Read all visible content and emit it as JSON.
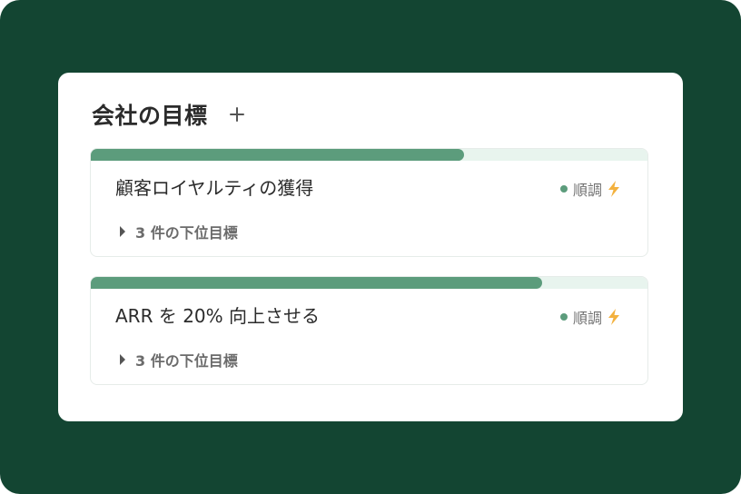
{
  "panel": {
    "title": "会社の目標",
    "add_icon": "plus-icon"
  },
  "goals": [
    {
      "title": "顧客ロイヤルティの獲得",
      "progress": 0.67,
      "status": "順調",
      "status_icon": "lightning-icon",
      "status_color": "#5c9c7c",
      "sub_goals": "3 件の下位目標"
    },
    {
      "title": "ARR を 20% 向上させる",
      "progress": 0.81,
      "status": "順調",
      "status_icon": "lightning-icon",
      "status_color": "#5c9c7c",
      "sub_goals": "3 件の下位目標"
    }
  ],
  "colors": {
    "background": "#134532",
    "progress_fill": "#5c9c7c",
    "progress_track": "#e8f4ee",
    "lightning": "#f3b13e"
  }
}
